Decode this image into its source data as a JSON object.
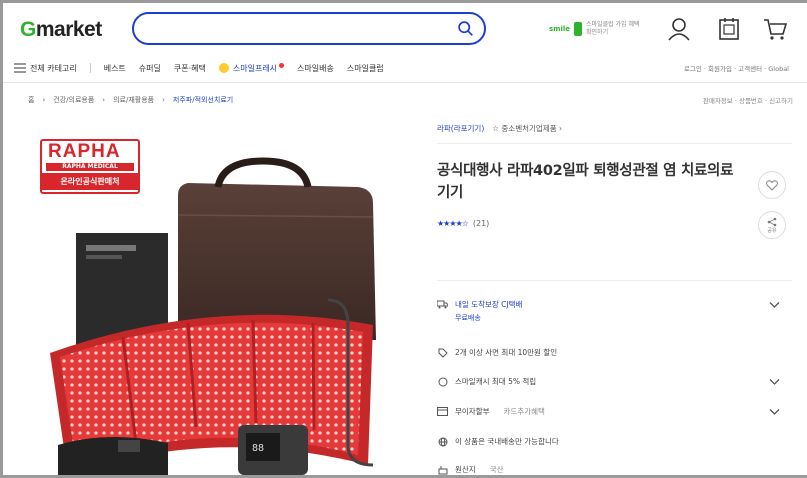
{
  "header": {
    "logo_g": "G",
    "logo_rest": "market",
    "search_placeholder": "",
    "promo_tag": "smile",
    "promo_text": "스마일클럽 가입 혜택 확인하기"
  },
  "nav": {
    "all_category": "전체 카테고리",
    "items": [
      "베스트",
      "슈퍼딜",
      "쿠폰·혜택"
    ],
    "smile_delivery": "스마일프레시",
    "items2": [
      "스마일배송",
      "스마일클럽"
    ],
    "right_links": "로그인 · 회원가입 · 고객센터 · Global"
  },
  "breadcrumb": {
    "home": "홈",
    "level1": "건강/의료용품",
    "level2": "의료/재활용품",
    "current": "저주파/적외선치료기",
    "right": "판매자정보 · 상품번호 · 신고하기"
  },
  "product_badge": {
    "brand": "RAPHA",
    "sub": "RAPHA MEDICAL",
    "official": "온라인공식판매처"
  },
  "details": {
    "brand_link": "라파(라포기기)",
    "shop_label": "중소벤처기업제품",
    "title": "공식대행사 라파402일파 퇴행성관절 염 치료의료기기",
    "rating_count": "(21)",
    "share_label": "공유",
    "rows": {
      "delivery": "내일 도착보장 CJ택배",
      "delivery_sub": "무료배송",
      "discount": "2개 이상 사면 최대 10만원 할인",
      "smile_point": "스마일캐시 최대 5% 적립",
      "smile_point_blue": "최대 5%",
      "card": "무이자할부",
      "card_sub": "카드추가혜택",
      "overseas": "이 상품은 국내배송만 가능합니다",
      "origin_label": "원산지",
      "origin_value": "국산"
    }
  },
  "colors": {
    "brand_blue": "#1c3ed0",
    "gmarket_green": "#2eb32e",
    "rapha_red": "#d8262c"
  }
}
